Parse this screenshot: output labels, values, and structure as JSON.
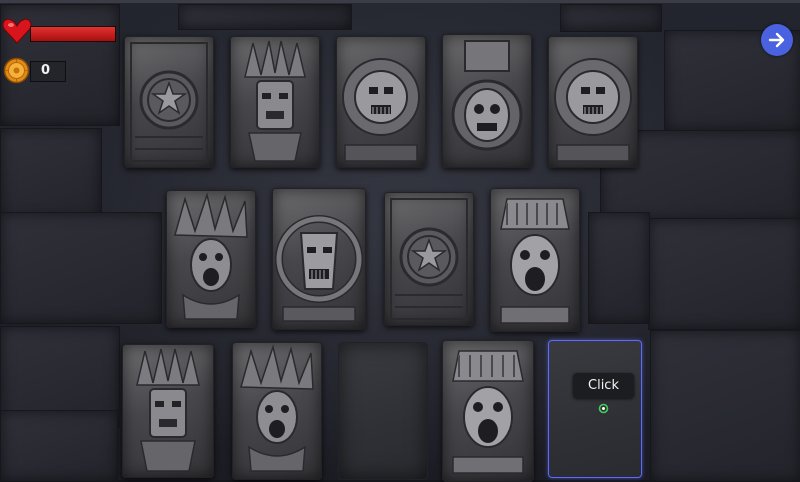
{
  "hud": {
    "health_fraction": 1.0,
    "coin_count": "0",
    "next_button": "arrow-right-icon"
  },
  "tooltip": {
    "text": "Click"
  },
  "cards": [
    {
      "row": 1,
      "col": 1,
      "face": "star-seal",
      "revealed": true
    },
    {
      "row": 1,
      "col": 2,
      "face": "feathered-idol",
      "revealed": true
    },
    {
      "row": 1,
      "col": 3,
      "face": "sun-mask",
      "revealed": true
    },
    {
      "row": 1,
      "col": 4,
      "face": "shield-mask",
      "revealed": true
    },
    {
      "row": 1,
      "col": 5,
      "face": "sun-mask",
      "revealed": true
    },
    {
      "row": 2,
      "col": 1,
      "face": "screaming-warrior",
      "revealed": true
    },
    {
      "row": 2,
      "col": 2,
      "face": "ring-mask",
      "revealed": true
    },
    {
      "row": 2,
      "col": 3,
      "face": "star-seal",
      "revealed": true
    },
    {
      "row": 2,
      "col": 4,
      "face": "screaming-idol",
      "revealed": true
    },
    {
      "row": 3,
      "col": 1,
      "face": "feathered-idol",
      "revealed": true
    },
    {
      "row": 3,
      "col": 2,
      "face": "screaming-warrior",
      "revealed": true
    },
    {
      "row": 3,
      "col": 3,
      "face": "blank",
      "revealed": false
    },
    {
      "row": 3,
      "col": 4,
      "face": "screaming-idol",
      "revealed": true
    },
    {
      "row": 3,
      "col": 5,
      "face": "blank",
      "revealed": false,
      "selected": true
    }
  ]
}
